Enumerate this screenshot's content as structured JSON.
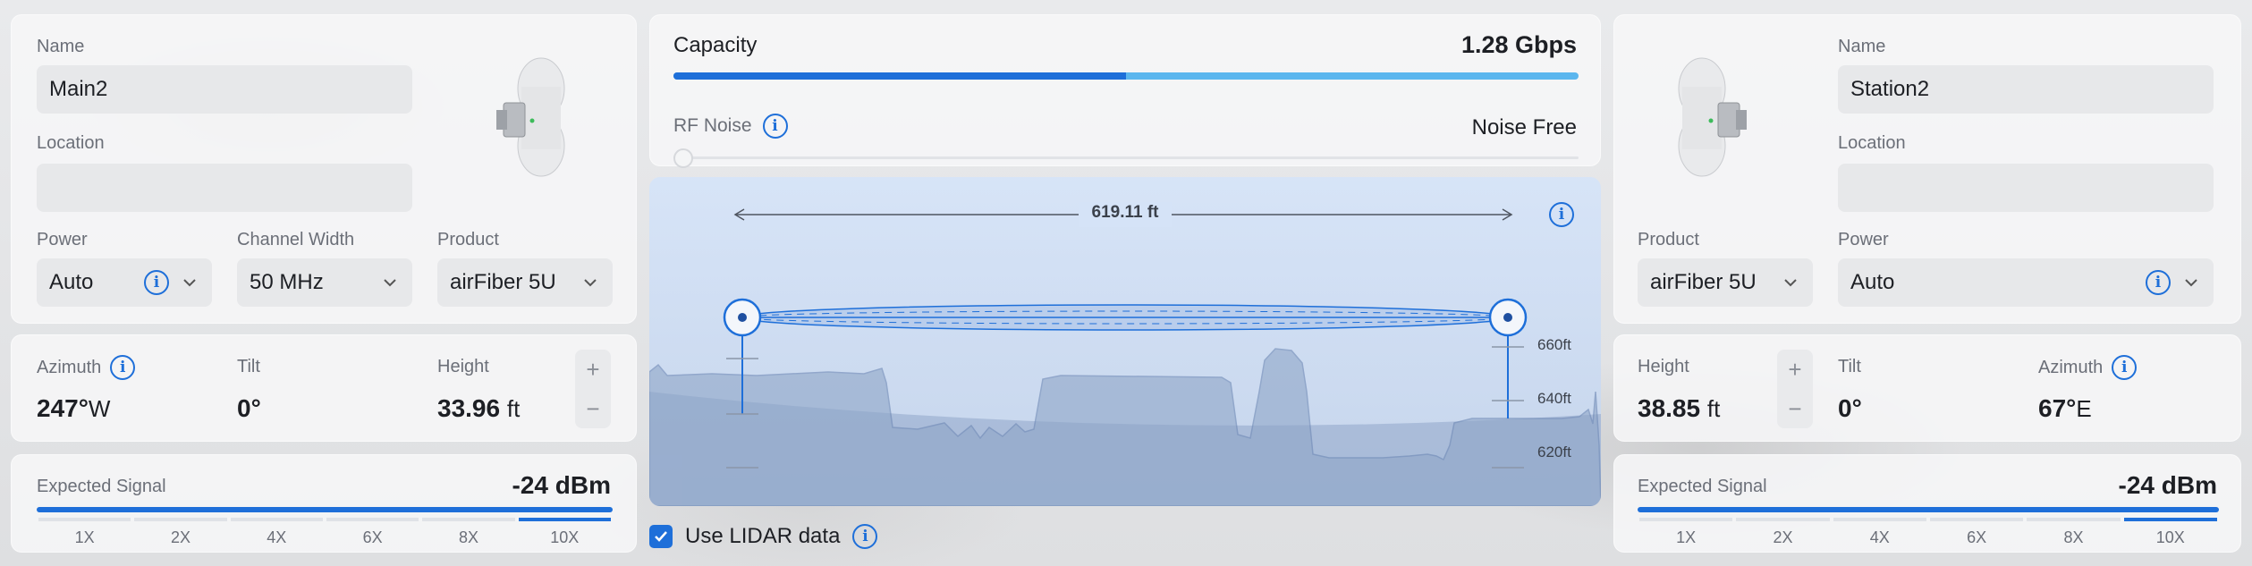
{
  "left": {
    "name_label": "Name",
    "name_value": "Main2",
    "location_label": "Location",
    "location_value": "",
    "power_label": "Power",
    "power_value": "Auto",
    "channel_label": "Channel Width",
    "channel_value": "50 MHz",
    "product_label": "Product",
    "product_value": "airFiber 5U",
    "azimuth_label": "Azimuth",
    "azimuth_value": "247°",
    "azimuth_dir": "W",
    "tilt_label": "Tilt",
    "tilt_value": "0°",
    "height_label": "Height",
    "height_value": "33.96",
    "height_unit": "ft",
    "signal_label": "Expected Signal",
    "signal_value": "-24 dBm",
    "ticks": [
      "1X",
      "2X",
      "4X",
      "6X",
      "8X",
      "10X"
    ]
  },
  "center": {
    "capacity_label": "Capacity",
    "capacity_value": "1.28 Gbps",
    "capacity_fraction": 0.5,
    "rf_noise_label": "RF Noise",
    "rf_noise_value": "Noise Free",
    "distance": "619.11 ft",
    "elev_labels": [
      "660ft",
      "640ft",
      "620ft"
    ],
    "lidar_label": "Use LIDAR data",
    "lidar_checked": true
  },
  "right": {
    "name_label": "Name",
    "name_value": "Station2",
    "location_label": "Location",
    "location_value": "",
    "product_label": "Product",
    "product_value": "airFiber 5U",
    "power_label": "Power",
    "power_value": "Auto",
    "height_label": "Height",
    "height_value": "38.85",
    "height_unit": "ft",
    "tilt_label": "Tilt",
    "tilt_value": "0°",
    "azimuth_label": "Azimuth",
    "azimuth_value": "67°",
    "azimuth_dir": "E",
    "signal_label": "Expected Signal",
    "signal_value": "-24 dBm",
    "ticks": [
      "1X",
      "2X",
      "4X",
      "6X",
      "8X",
      "10X"
    ]
  },
  "colors": {
    "accent": "#1e6fd9",
    "accent_light": "#5bb6ee",
    "terrain": "#8fa6c8"
  }
}
